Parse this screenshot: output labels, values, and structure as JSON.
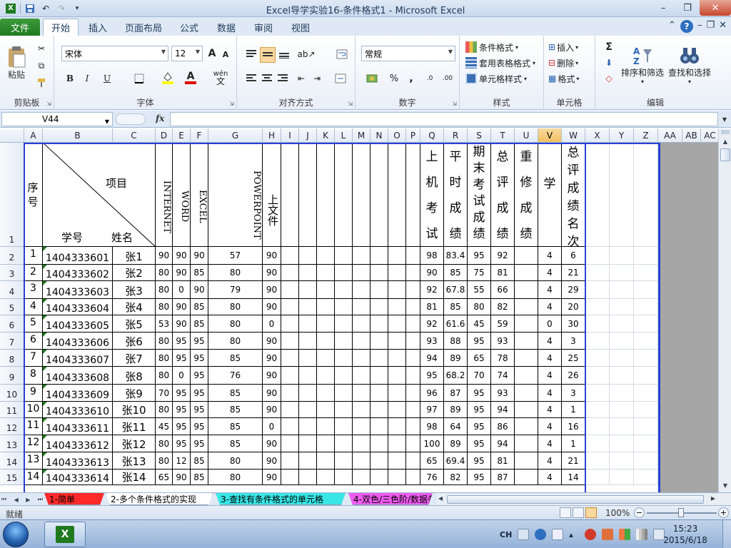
{
  "window": {
    "title": "Excel导学实验16-条件格式1 - Microsoft Excel"
  },
  "ribbon": {
    "file_label": "文件",
    "tabs": [
      "开始",
      "插入",
      "页面布局",
      "公式",
      "数据",
      "审阅",
      "视图"
    ],
    "clipboard": {
      "paste": "粘贴",
      "label": "剪贴板"
    },
    "font": {
      "name": "宋体",
      "size": "12",
      "label": "字体",
      "bold": "B",
      "italic": "I",
      "underline": "U",
      "grow": "A",
      "shrink": "A",
      "font_color": "A",
      "phonetic": "wén"
    },
    "alignment": {
      "label": "对齐方式"
    },
    "number": {
      "format": "常规",
      "label": "数字",
      "percent": "%",
      "comma": ",",
      "inc_decimal": ".0",
      "dec_decimal": ".00"
    },
    "styles": {
      "cond_format": "条件格式",
      "table_format": "套用表格格式",
      "cell_styles": "单元格样式",
      "label": "样式"
    },
    "cells": {
      "insert": "插入",
      "delete": "删除",
      "format": "格式",
      "label": "单元格"
    },
    "editing": {
      "sum": "Σ",
      "sort_filter": "排序和筛选",
      "find_select": "查找和选择",
      "label": "编辑"
    }
  },
  "formula_bar": {
    "name_box": "V44",
    "fx": "fx",
    "value": ""
  },
  "grid": {
    "columns": [
      "A",
      "B",
      "C",
      "D",
      "E",
      "F",
      "G",
      "H",
      "I",
      "J",
      "K",
      "L",
      "M",
      "N",
      "O",
      "P",
      "Q",
      "R",
      "S",
      "T",
      "U",
      "V",
      "W",
      "X",
      "Y",
      "Z",
      "AA",
      "AB",
      "AC"
    ],
    "selected_column": "V",
    "row_numbers": [
      "1",
      "2",
      "3",
      "4",
      "5",
      "6",
      "7",
      "8",
      "9",
      "10",
      "11",
      "12",
      "13",
      "14",
      "15"
    ],
    "header": {
      "seq": "序号",
      "item": "项目",
      "student_id": "学号",
      "name": "姓名",
      "internet": "INTERNET",
      "word": "WORD",
      "excel": "EXCEL",
      "powerpoint": "POWERPOINT",
      "zip": "上文件",
      "onmachine": "上机考试",
      "usual": "平时成绩",
      "final": "期末考试成绩",
      "total": "总评成绩",
      "retake": "重修成绩",
      "credit": "学分",
      "rank": "总评成绩名次"
    },
    "rows": [
      [
        "1",
        "1404333601",
        "张1",
        "90",
        "90",
        "90",
        "57",
        "90",
        "98",
        "83.4",
        "95",
        "92",
        "4",
        "6"
      ],
      [
        "2",
        "1404333602",
        "张2",
        "80",
        "90",
        "85",
        "80",
        "90",
        "90",
        "85",
        "75",
        "81",
        "4",
        "21"
      ],
      [
        "3",
        "1404333603",
        "张3",
        "80",
        "0",
        "90",
        "79",
        "90",
        "92",
        "67.8",
        "55",
        "66",
        "4",
        "29"
      ],
      [
        "4",
        "1404333604",
        "张4",
        "80",
        "90",
        "85",
        "80",
        "90",
        "81",
        "85",
        "80",
        "82",
        "4",
        "20"
      ],
      [
        "5",
        "1404333605",
        "张5",
        "53",
        "90",
        "85",
        "80",
        "0",
        "92",
        "61.6",
        "45",
        "59",
        "0",
        "30"
      ],
      [
        "6",
        "1404333606",
        "张6",
        "80",
        "95",
        "95",
        "80",
        "90",
        "93",
        "88",
        "95",
        "93",
        "4",
        "3"
      ],
      [
        "7",
        "1404333607",
        "张7",
        "80",
        "95",
        "95",
        "85",
        "90",
        "94",
        "89",
        "65",
        "78",
        "4",
        "25"
      ],
      [
        "8",
        "1404333608",
        "张8",
        "80",
        "0",
        "95",
        "76",
        "90",
        "95",
        "68.2",
        "70",
        "74",
        "4",
        "26"
      ],
      [
        "9",
        "1404333609",
        "张9",
        "70",
        "95",
        "95",
        "85",
        "90",
        "96",
        "87",
        "95",
        "93",
        "4",
        "3"
      ],
      [
        "10",
        "1404333610",
        "张10",
        "80",
        "95",
        "95",
        "85",
        "90",
        "97",
        "89",
        "95",
        "94",
        "4",
        "1"
      ],
      [
        "11",
        "1404333611",
        "张11",
        "45",
        "95",
        "95",
        "85",
        "0",
        "98",
        "64",
        "95",
        "86",
        "4",
        "16"
      ],
      [
        "12",
        "1404333612",
        "张12",
        "80",
        "95",
        "95",
        "85",
        "90",
        "100",
        "89",
        "95",
        "94",
        "4",
        "1"
      ],
      [
        "13",
        "1404333613",
        "张13",
        "80",
        "12",
        "85",
        "80",
        "90",
        "65",
        "69.4",
        "95",
        "81",
        "4",
        "21"
      ],
      [
        "14",
        "1404333614",
        "张14",
        "65",
        "90",
        "85",
        "80",
        "90",
        "76",
        "82",
        "95",
        "87",
        "4",
        "14"
      ]
    ]
  },
  "sheet_tabs": [
    {
      "label": "1-简单",
      "color": "#ff2a2a"
    },
    {
      "label": "2-多个条件格式的实现",
      "color": "#ffffff"
    },
    {
      "label": "3-查找有条件格式的单元格",
      "color": "#39e6e6"
    },
    {
      "label": "4-双色/三色阶/数据条",
      "color": "#f05cf0"
    }
  ],
  "status": {
    "ready": "就绪",
    "zoom": "100%"
  },
  "taskbar": {
    "ime": "CH",
    "time": "15:23",
    "date": "2015/6/18"
  }
}
